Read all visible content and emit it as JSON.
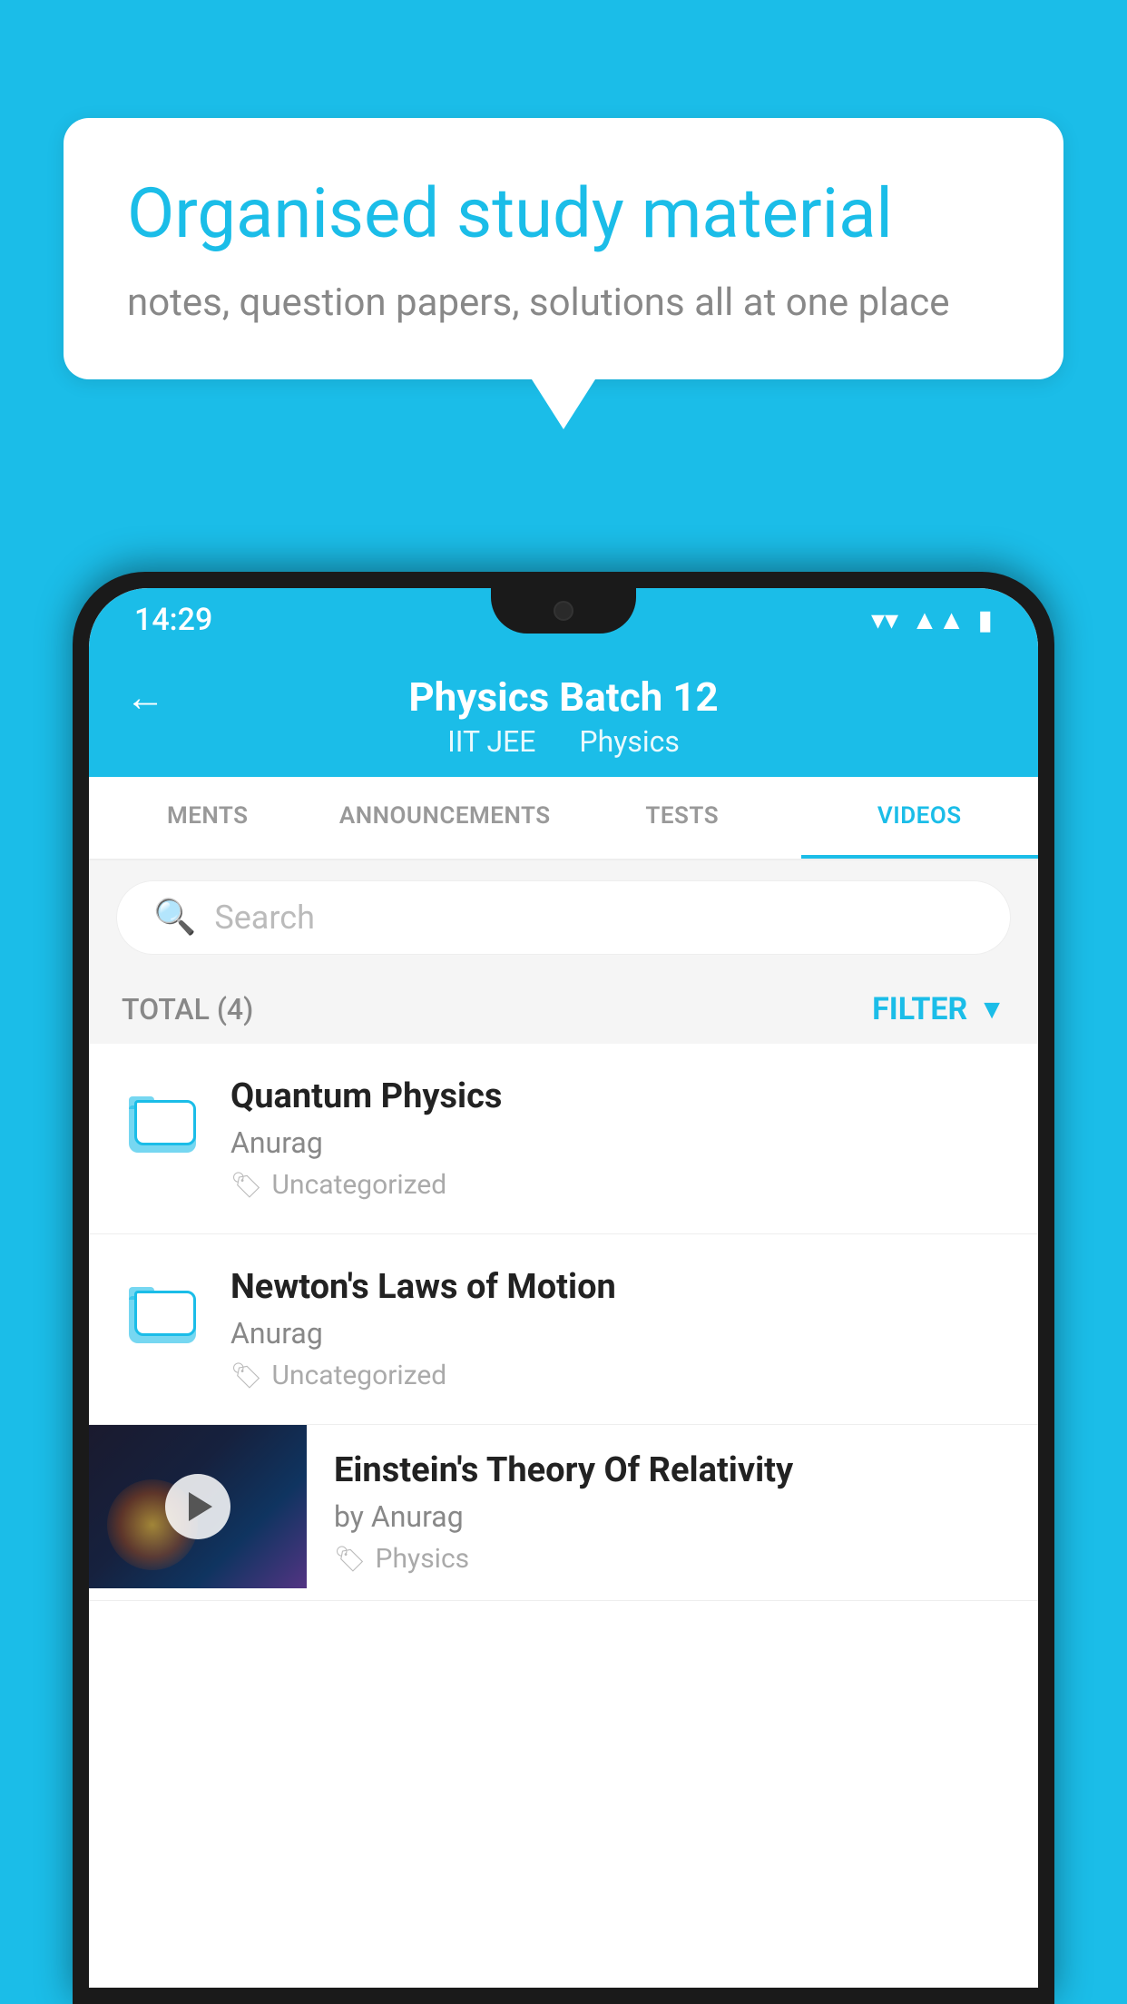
{
  "background_color": "#1BBDE8",
  "speech_bubble": {
    "title": "Organised study material",
    "subtitle": "notes, question papers, solutions all at one place"
  },
  "status_bar": {
    "time": "14:29"
  },
  "app_header": {
    "title": "Physics Batch 12",
    "subtitle_part1": "IIT JEE",
    "subtitle_part2": "Physics"
  },
  "tabs": [
    {
      "label": "MENTS",
      "active": false
    },
    {
      "label": "ANNOUNCEMENTS",
      "active": false
    },
    {
      "label": "TESTS",
      "active": false
    },
    {
      "label": "VIDEOS",
      "active": true
    }
  ],
  "search": {
    "placeholder": "Search"
  },
  "filter": {
    "total_label": "TOTAL (4)",
    "filter_label": "FILTER"
  },
  "list_items": [
    {
      "title": "Quantum Physics",
      "author": "Anurag",
      "tag": "Uncategorized",
      "type": "folder"
    },
    {
      "title": "Newton's Laws of Motion",
      "author": "Anurag",
      "tag": "Uncategorized",
      "type": "folder"
    }
  ],
  "video_item": {
    "title": "Einstein's Theory Of Relativity",
    "author": "by Anurag",
    "tag": "Physics",
    "type": "video"
  }
}
